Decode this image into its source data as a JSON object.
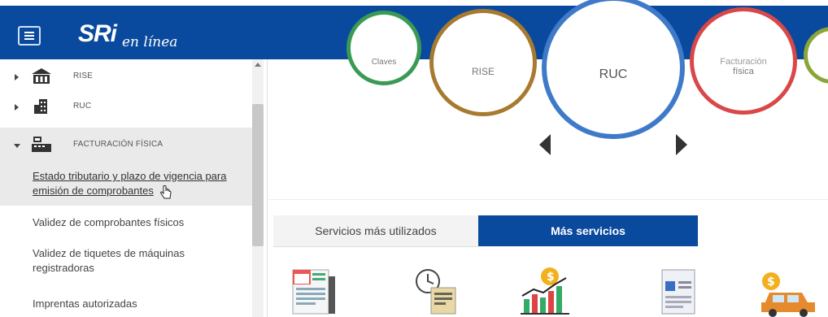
{
  "header": {
    "logo_text": "SRi",
    "logo_sub": "en línea",
    "brand_color": "#0a4a9e",
    "menu_icon": "hamburger-icon"
  },
  "sidebar": {
    "items": [
      {
        "label": "RISE",
        "icon": "rise-building-icon",
        "expanded": false
      },
      {
        "label": "RUC",
        "icon": "ruc-building-icon",
        "expanded": false
      },
      {
        "label": "FACTURACIÓN FÍSICA",
        "icon": "cash-register-icon",
        "expanded": true
      }
    ],
    "subitems": [
      {
        "line1": "Estado tributario y plazo de vigencia para",
        "line2": "emisión de comprobantes"
      },
      {
        "line1": "Validez de comprobantes físicos"
      },
      {
        "line1": "Validez de tiquetes de máquinas",
        "line2": "registradoras"
      },
      {
        "line1": "Imprentas autorizadas"
      }
    ]
  },
  "carousel": {
    "items": [
      {
        "label": "Claves",
        "color": "#3a9a55"
      },
      {
        "label": "RISE",
        "color": "#a77a2f"
      },
      {
        "label": "RUC",
        "color": "#3e7ac9"
      },
      {
        "label_line1": "Facturación",
        "label_line2": "física",
        "color": "#d94848"
      }
    ]
  },
  "tabs": [
    {
      "label": "Servicios más utilizados",
      "active": false
    },
    {
      "label": "Más servicios",
      "active": true
    }
  ],
  "services": [
    {
      "icon": "calendar-document-icon"
    },
    {
      "icon": "clock-document-icon"
    },
    {
      "icon": "growth-chart-icon"
    },
    {
      "icon": "id-document-icon"
    },
    {
      "icon": "vehicle-tax-icon"
    }
  ]
}
